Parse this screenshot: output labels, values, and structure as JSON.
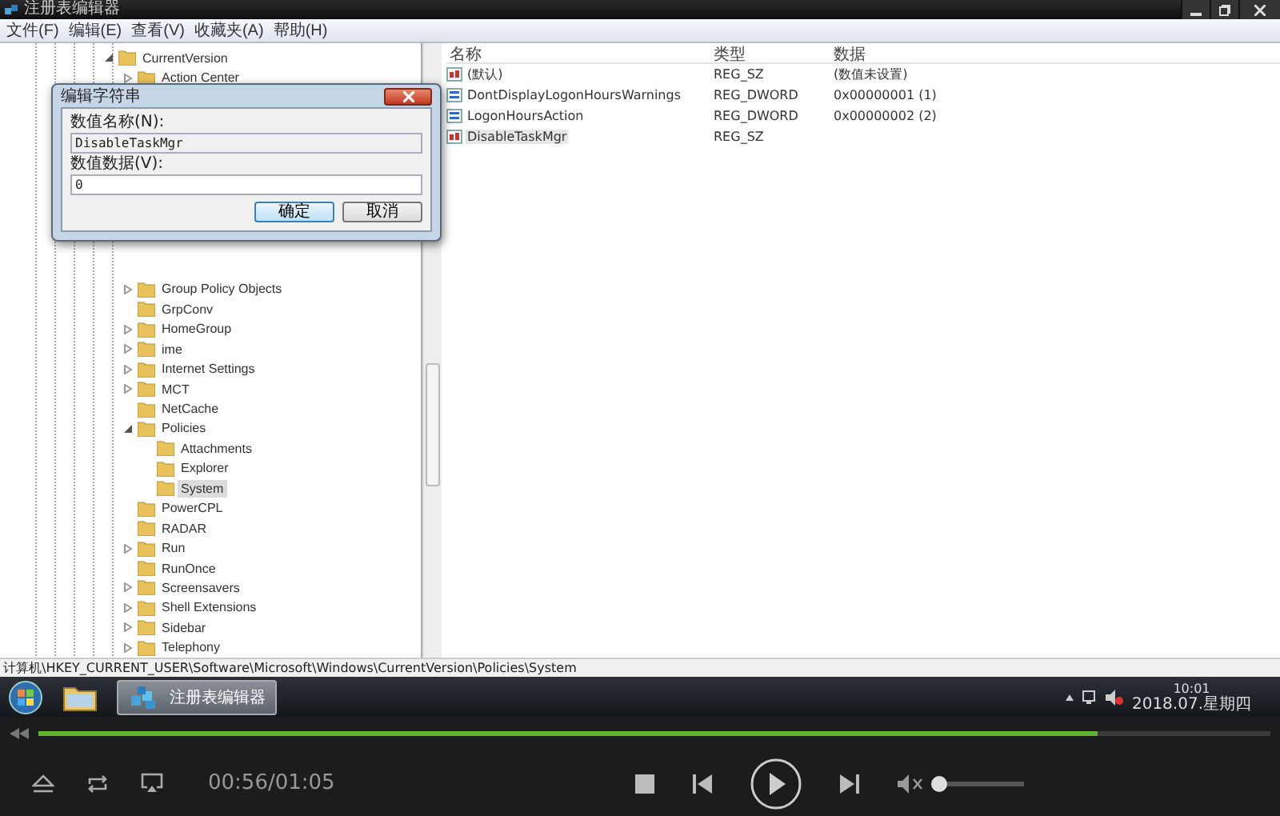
{
  "window": {
    "title": "注册表编辑器"
  },
  "menu": [
    "文件(F)",
    "编辑(E)",
    "查看(V)",
    "收藏夹(A)",
    "帮助(H)"
  ],
  "tree": [
    {
      "label": "CurrentVersion",
      "expanded": true,
      "selected": false,
      "children": [
        {
          "label": "Action Center",
          "expanded": false,
          "selected": false
        },
        {
          "label": "Group Policy Objects",
          "expanded": false,
          "selected": false
        },
        {
          "label": "GrpConv",
          "selected": false
        },
        {
          "label": "HomeGroup",
          "expanded": false,
          "selected": false
        },
        {
          "label": "ime",
          "expanded": false,
          "selected": false
        },
        {
          "label": "Internet Settings",
          "expanded": false,
          "selected": false
        },
        {
          "label": "MCT",
          "expanded": false,
          "selected": false
        },
        {
          "label": "NetCache",
          "selected": false
        },
        {
          "label": "Policies",
          "expanded": true,
          "selected": false,
          "children": [
            {
              "label": "Attachments",
              "selected": false
            },
            {
              "label": "Explorer",
              "selected": false
            },
            {
              "label": "System",
              "selected": true
            }
          ]
        },
        {
          "label": "PowerCPL",
          "selected": false
        },
        {
          "label": "RADAR",
          "selected": false
        },
        {
          "label": "Run",
          "expanded": false,
          "selected": false
        },
        {
          "label": "RunOnce",
          "selected": false
        },
        {
          "label": "Screensavers",
          "expanded": false,
          "selected": false
        },
        {
          "label": "Shell Extensions",
          "expanded": false,
          "selected": false
        },
        {
          "label": "Sidebar",
          "expanded": false,
          "selected": false
        },
        {
          "label": "Telephony",
          "expanded": false,
          "selected": false
        }
      ]
    }
  ],
  "list": {
    "columns": [
      "名称",
      "类型",
      "数据"
    ],
    "rows": [
      {
        "kind": "string",
        "name": "(默认)",
        "type": "REG_SZ",
        "data": "(数值未设置)",
        "selected": false
      },
      {
        "kind": "dword",
        "name": "DontDisplayLogonHoursWarnings",
        "type": "REG_DWORD",
        "data": "0x00000001 (1)",
        "selected": false
      },
      {
        "kind": "dword",
        "name": "LogonHoursAction",
        "type": "REG_DWORD",
        "data": "0x00000002 (2)",
        "selected": false
      },
      {
        "kind": "string",
        "name": "DisableTaskMgr",
        "type": "REG_SZ",
        "selected": true
      }
    ]
  },
  "status_bar": "计算机\\HKEY_CURRENT_USER\\Software\\Microsoft\\Windows\\CurrentVersion\\Policies\\System",
  "dialog": {
    "title": "编辑字符串",
    "name_label": "数值名称(N):",
    "name_value": "DisableTaskMgr",
    "data_label": "数值数据(V):",
    "data_value": "0",
    "buttons": [
      {
        "label": "确定",
        "selected": true
      },
      {
        "label": "取消",
        "selected": false
      }
    ]
  },
  "taskbar": {
    "tasks": [
      {
        "kind": "pinned",
        "selected": false
      },
      {
        "kind": "window",
        "label": "注册表编辑器",
        "selected": true
      }
    ],
    "clock": {
      "time": "10:01",
      "date": "2018.07.星期四"
    }
  },
  "player": {
    "level": 0.86,
    "time": "00:56/01:05",
    "volume": {
      "muted": true,
      "level": 0
    }
  }
}
